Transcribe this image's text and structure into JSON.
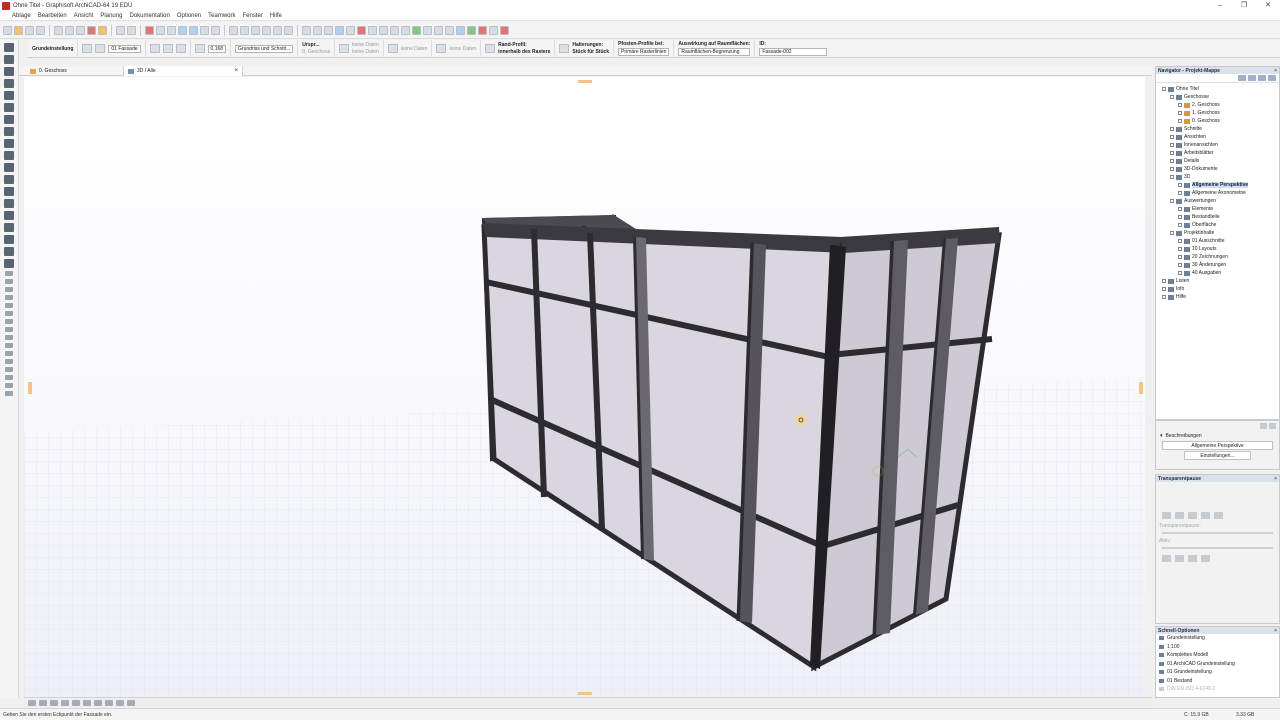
{
  "window": {
    "title": "Ohne Titel - Graphisoft ArchiCAD-64 19 EDU",
    "controls": [
      "–",
      "❐",
      "✕"
    ]
  },
  "menu": [
    "Ablage",
    "Bearbeiten",
    "Ansicht",
    "Planung",
    "Dokumentation",
    "Optionen",
    "Teamwork",
    "Fenster",
    "Hilfe"
  ],
  "infobox": {
    "preset": "Grundeinstellung",
    "layer": "01 Fassade",
    "offset_value": "0,168",
    "view_button": "Grundriss und Schnitt...",
    "origin_label": "Urspr...",
    "story": "0. Geschoss",
    "no_data": "keine Daten",
    "border_profile_label": "Rand-Profil:",
    "border_profile_value": "innerhalb des Rasters",
    "brackets_label": "Halterungen:",
    "brackets_value": "Stück für Stück",
    "mullion_label": "Pfosten-Profile bei:",
    "mullion_value": "Primäre Rasterlinien",
    "zone_effect_label": "Auswirkung auf Raumflächen:",
    "zone_effect_value": "Raumflächen-Begrenzung",
    "id_label": "ID:",
    "id_value": "Fassade-002"
  },
  "tabs": [
    {
      "label": "0. Geschoss"
    },
    {
      "label": "3D / Alle",
      "close": "×"
    }
  ],
  "navigator": {
    "title": "Navigator - Projekt-Mappe",
    "tree": [
      {
        "label": "Ohne Titel",
        "depth": 0
      },
      {
        "label": "Geschosse",
        "depth": 1
      },
      {
        "label": "2. Geschoss",
        "depth": 2
      },
      {
        "label": "1. Geschoss",
        "depth": 2
      },
      {
        "label": "0. Geschoss",
        "depth": 2
      },
      {
        "label": "Schnitte",
        "depth": 1
      },
      {
        "label": "Ansichten",
        "depth": 1
      },
      {
        "label": "Innenansichten",
        "depth": 1
      },
      {
        "label": "Arbeitsblätter",
        "depth": 1
      },
      {
        "label": "Details",
        "depth": 1
      },
      {
        "label": "3D-Dokumente",
        "depth": 1
      },
      {
        "label": "3D",
        "depth": 1
      },
      {
        "label": "Allgemeine Perspektive",
        "depth": 2,
        "selected": true
      },
      {
        "label": "Allgemeine Axonometrie",
        "depth": 2
      },
      {
        "label": "Auswertungen",
        "depth": 1
      },
      {
        "label": "Elemente",
        "depth": 2
      },
      {
        "label": "Bestandteile",
        "depth": 2
      },
      {
        "label": "Oberfläche",
        "depth": 2
      },
      {
        "label": "Projektinhalte",
        "depth": 1
      },
      {
        "label": "01 Ausschnitte",
        "depth": 2
      },
      {
        "label": "10 Layouts",
        "depth": 2
      },
      {
        "label": "20 Zeichnungen",
        "depth": 2
      },
      {
        "label": "30 Änderungen",
        "depth": 2
      },
      {
        "label": "40 Ausgaben",
        "depth": 2
      },
      {
        "label": "Listen",
        "depth": 0
      },
      {
        "label": "Info",
        "depth": 0
      },
      {
        "label": "Hilfe",
        "depth": 0
      }
    ]
  },
  "description": {
    "header": "Beschreibungen",
    "view_name": "Allgemeine Perspektive",
    "settings_button": "Einstellungen..."
  },
  "transparency": {
    "title": "Transparentpause",
    "label": "Transparentpause:",
    "alt_label": "Aktiv:"
  },
  "quick_options": {
    "title": "Schnell-Optionen",
    "items": [
      "Grundeinstellung",
      "1:100",
      "Komplettes Modell",
      "01 ArchiCAD Grundeinstellung",
      "01 Grundeinstellung",
      "01 Bestand",
      "DIN EN ISO 4-6240-2"
    ]
  },
  "status": {
    "message": "Geben Sie den ersten Eckpunkt der Fassade ein.",
    "disk": "C: 15.9 GB",
    "ram": "3.33 GB"
  },
  "colors": {
    "accent": "#1e2c45",
    "panel_header": "#dbe2ec",
    "glass": "#d9d6df",
    "frame": "#2f2f33"
  }
}
